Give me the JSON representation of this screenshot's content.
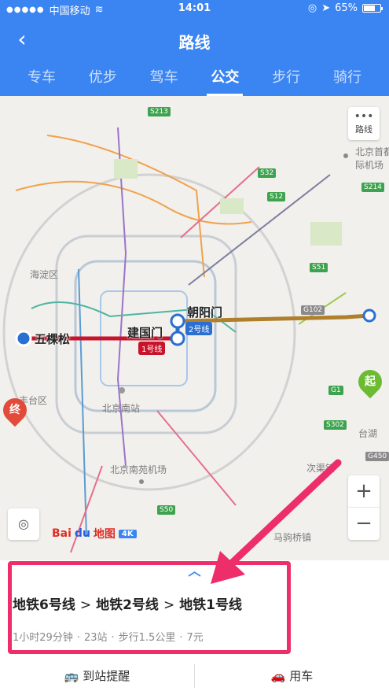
{
  "status": {
    "carrier": "中国移动",
    "time": "14:01",
    "battery": "65%"
  },
  "nav": {
    "title": "路线",
    "back_glyph": "‹"
  },
  "tabs": [
    {
      "label": "专车"
    },
    {
      "label": "优步"
    },
    {
      "label": "驾车"
    },
    {
      "label": "公交"
    },
    {
      "label": "步行"
    },
    {
      "label": "骑行"
    }
  ],
  "active_tab": "公交",
  "map": {
    "route_button_label": "路线",
    "district_labels": [
      "海淀区",
      "丰台区",
      "北京南站",
      "北京南苑机场",
      "次渠镇",
      "马驹桥镇",
      "台湖",
      "北京首都国际机场"
    ],
    "stations": {
      "end": "五棵松",
      "transfer1": "建国门",
      "transfer2": "朝阳门"
    },
    "line_badges": {
      "line1": "1号线",
      "line2": "2号线"
    },
    "road_badges": [
      "S213",
      "S32",
      "S12",
      "S214",
      "S51",
      "G102",
      "G1",
      "S302",
      "S50",
      "G450"
    ],
    "markers": {
      "start": "起",
      "end": "终"
    },
    "zoom_in": "+",
    "zoom_out": "−",
    "logo": {
      "brand": "Bai",
      "du": "du",
      "map": "地图",
      "badge": "4K"
    }
  },
  "route": {
    "lines": [
      "地铁6号线",
      "地铁2号线",
      "地铁1号线"
    ],
    "separator": ">",
    "duration": "1小时29分钟",
    "stops": "23站",
    "walk": "步行1.5公里",
    "fare": "7元"
  },
  "actions": {
    "alert": "到站提醒",
    "car": "用车"
  },
  "colors": {
    "primary": "#3b85f2",
    "highlight": "#ee2d6b",
    "line1": "#c8132a",
    "line2": "#2a6fd1",
    "line6": "#b07f2c"
  }
}
